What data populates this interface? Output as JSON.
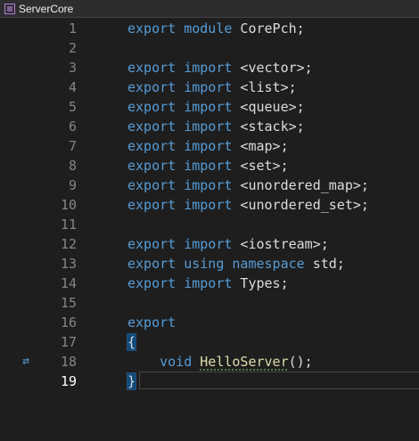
{
  "window": {
    "title": "ServerCore"
  },
  "editor": {
    "current_line": 19,
    "lines": [
      {
        "n": "1",
        "tokens": [
          {
            "t": "export",
            "c": "kw"
          },
          {
            "t": " ",
            "c": "plain"
          },
          {
            "t": "module",
            "c": "kw"
          },
          {
            "t": " CorePch;",
            "c": "plain"
          }
        ]
      },
      {
        "n": "2",
        "tokens": []
      },
      {
        "n": "3",
        "tokens": [
          {
            "t": "export",
            "c": "kw"
          },
          {
            "t": " ",
            "c": "plain"
          },
          {
            "t": "import",
            "c": "kw"
          },
          {
            "t": " <vector>;",
            "c": "plain"
          }
        ]
      },
      {
        "n": "4",
        "tokens": [
          {
            "t": "export",
            "c": "kw"
          },
          {
            "t": " ",
            "c": "plain"
          },
          {
            "t": "import",
            "c": "kw"
          },
          {
            "t": " <list>;",
            "c": "plain"
          }
        ]
      },
      {
        "n": "5",
        "tokens": [
          {
            "t": "export",
            "c": "kw"
          },
          {
            "t": " ",
            "c": "plain"
          },
          {
            "t": "import",
            "c": "kw"
          },
          {
            "t": " <queue>;",
            "c": "plain"
          }
        ]
      },
      {
        "n": "6",
        "tokens": [
          {
            "t": "export",
            "c": "kw"
          },
          {
            "t": " ",
            "c": "plain"
          },
          {
            "t": "import",
            "c": "kw"
          },
          {
            "t": " <stack>;",
            "c": "plain"
          }
        ]
      },
      {
        "n": "7",
        "tokens": [
          {
            "t": "export",
            "c": "kw"
          },
          {
            "t": " ",
            "c": "plain"
          },
          {
            "t": "import",
            "c": "kw"
          },
          {
            "t": " <map>;",
            "c": "plain"
          }
        ]
      },
      {
        "n": "8",
        "tokens": [
          {
            "t": "export",
            "c": "kw"
          },
          {
            "t": " ",
            "c": "plain"
          },
          {
            "t": "import",
            "c": "kw"
          },
          {
            "t": " <set>;",
            "c": "plain"
          }
        ]
      },
      {
        "n": "9",
        "tokens": [
          {
            "t": "export",
            "c": "kw"
          },
          {
            "t": " ",
            "c": "plain"
          },
          {
            "t": "import",
            "c": "kw"
          },
          {
            "t": " <unordered_map>;",
            "c": "plain"
          }
        ]
      },
      {
        "n": "10",
        "tokens": [
          {
            "t": "export",
            "c": "kw"
          },
          {
            "t": " ",
            "c": "plain"
          },
          {
            "t": "import",
            "c": "kw"
          },
          {
            "t": " <unordered_set>;",
            "c": "plain"
          }
        ]
      },
      {
        "n": "11",
        "tokens": []
      },
      {
        "n": "12",
        "tokens": [
          {
            "t": "export",
            "c": "kw"
          },
          {
            "t": " ",
            "c": "plain"
          },
          {
            "t": "import",
            "c": "kw"
          },
          {
            "t": " <iostream>;",
            "c": "plain"
          }
        ]
      },
      {
        "n": "13",
        "tokens": [
          {
            "t": "export",
            "c": "kw"
          },
          {
            "t": " ",
            "c": "plain"
          },
          {
            "t": "using",
            "c": "kw"
          },
          {
            "t": " ",
            "c": "plain"
          },
          {
            "t": "namespace",
            "c": "kw"
          },
          {
            "t": " std;",
            "c": "plain"
          }
        ]
      },
      {
        "n": "14",
        "tokens": [
          {
            "t": "export",
            "c": "kw"
          },
          {
            "t": " ",
            "c": "plain"
          },
          {
            "t": "import",
            "c": "kw"
          },
          {
            "t": " Types;",
            "c": "plain"
          }
        ]
      },
      {
        "n": "15",
        "tokens": []
      },
      {
        "n": "16",
        "tokens": [
          {
            "t": "export",
            "c": "kw"
          }
        ]
      },
      {
        "n": "17",
        "tokens": [
          {
            "t": "{",
            "c": "plain brace-hl"
          }
        ]
      },
      {
        "n": "18",
        "icon": "⇄",
        "tokens": [
          {
            "t": "    ",
            "c": "plain"
          },
          {
            "t": "void",
            "c": "kw"
          },
          {
            "t": " ",
            "c": "plain"
          },
          {
            "t": "HelloServer",
            "c": "fn"
          },
          {
            "t": "();",
            "c": "plain"
          }
        ]
      },
      {
        "n": "19",
        "tokens": [
          {
            "t": "}",
            "c": "plain brace-hl"
          }
        ]
      }
    ]
  },
  "colors": {
    "background": "#1e1e1e",
    "keyword": "#569cd6",
    "function": "#dcdcaa",
    "text": "#dcdcdc",
    "line_number": "#858585"
  }
}
